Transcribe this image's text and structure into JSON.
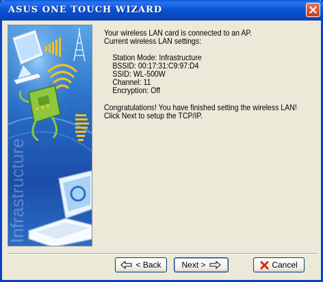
{
  "window": {
    "title": "ASUS ONE TOUCH WIZARD"
  },
  "side_panel": {
    "watermark": "Infrastructure"
  },
  "message": {
    "intro_line1": "Your wireless LAN card is connected to an AP.",
    "intro_line2": "Current wireless LAN settings:",
    "settings": [
      "Station Mode: Infrastructure",
      "BSSID:  00:17:31:C9:97:D4",
      "SSID:   WL-500W",
      "Channel:  11",
      "Encryption:  Off"
    ],
    "congrats_line1": "Congratulations! You have finished setting the wireless LAN!",
    "congrats_line2": "Click Next to setup the TCP/IP."
  },
  "buttons": {
    "back_label": "< Back",
    "next_label": "Next >",
    "cancel_label": "Cancel"
  },
  "icons": {
    "close": "close-icon",
    "back": "arrow-left-icon",
    "next": "arrow-right-icon",
    "cancel": "red-x-icon"
  },
  "colors": {
    "titlebar": "#0a55d8",
    "window_bg": "#ece9d8",
    "panel_blue": "#1a4da8",
    "accent_yellow": "#f4c21a",
    "cancel_red": "#d42a0a"
  }
}
